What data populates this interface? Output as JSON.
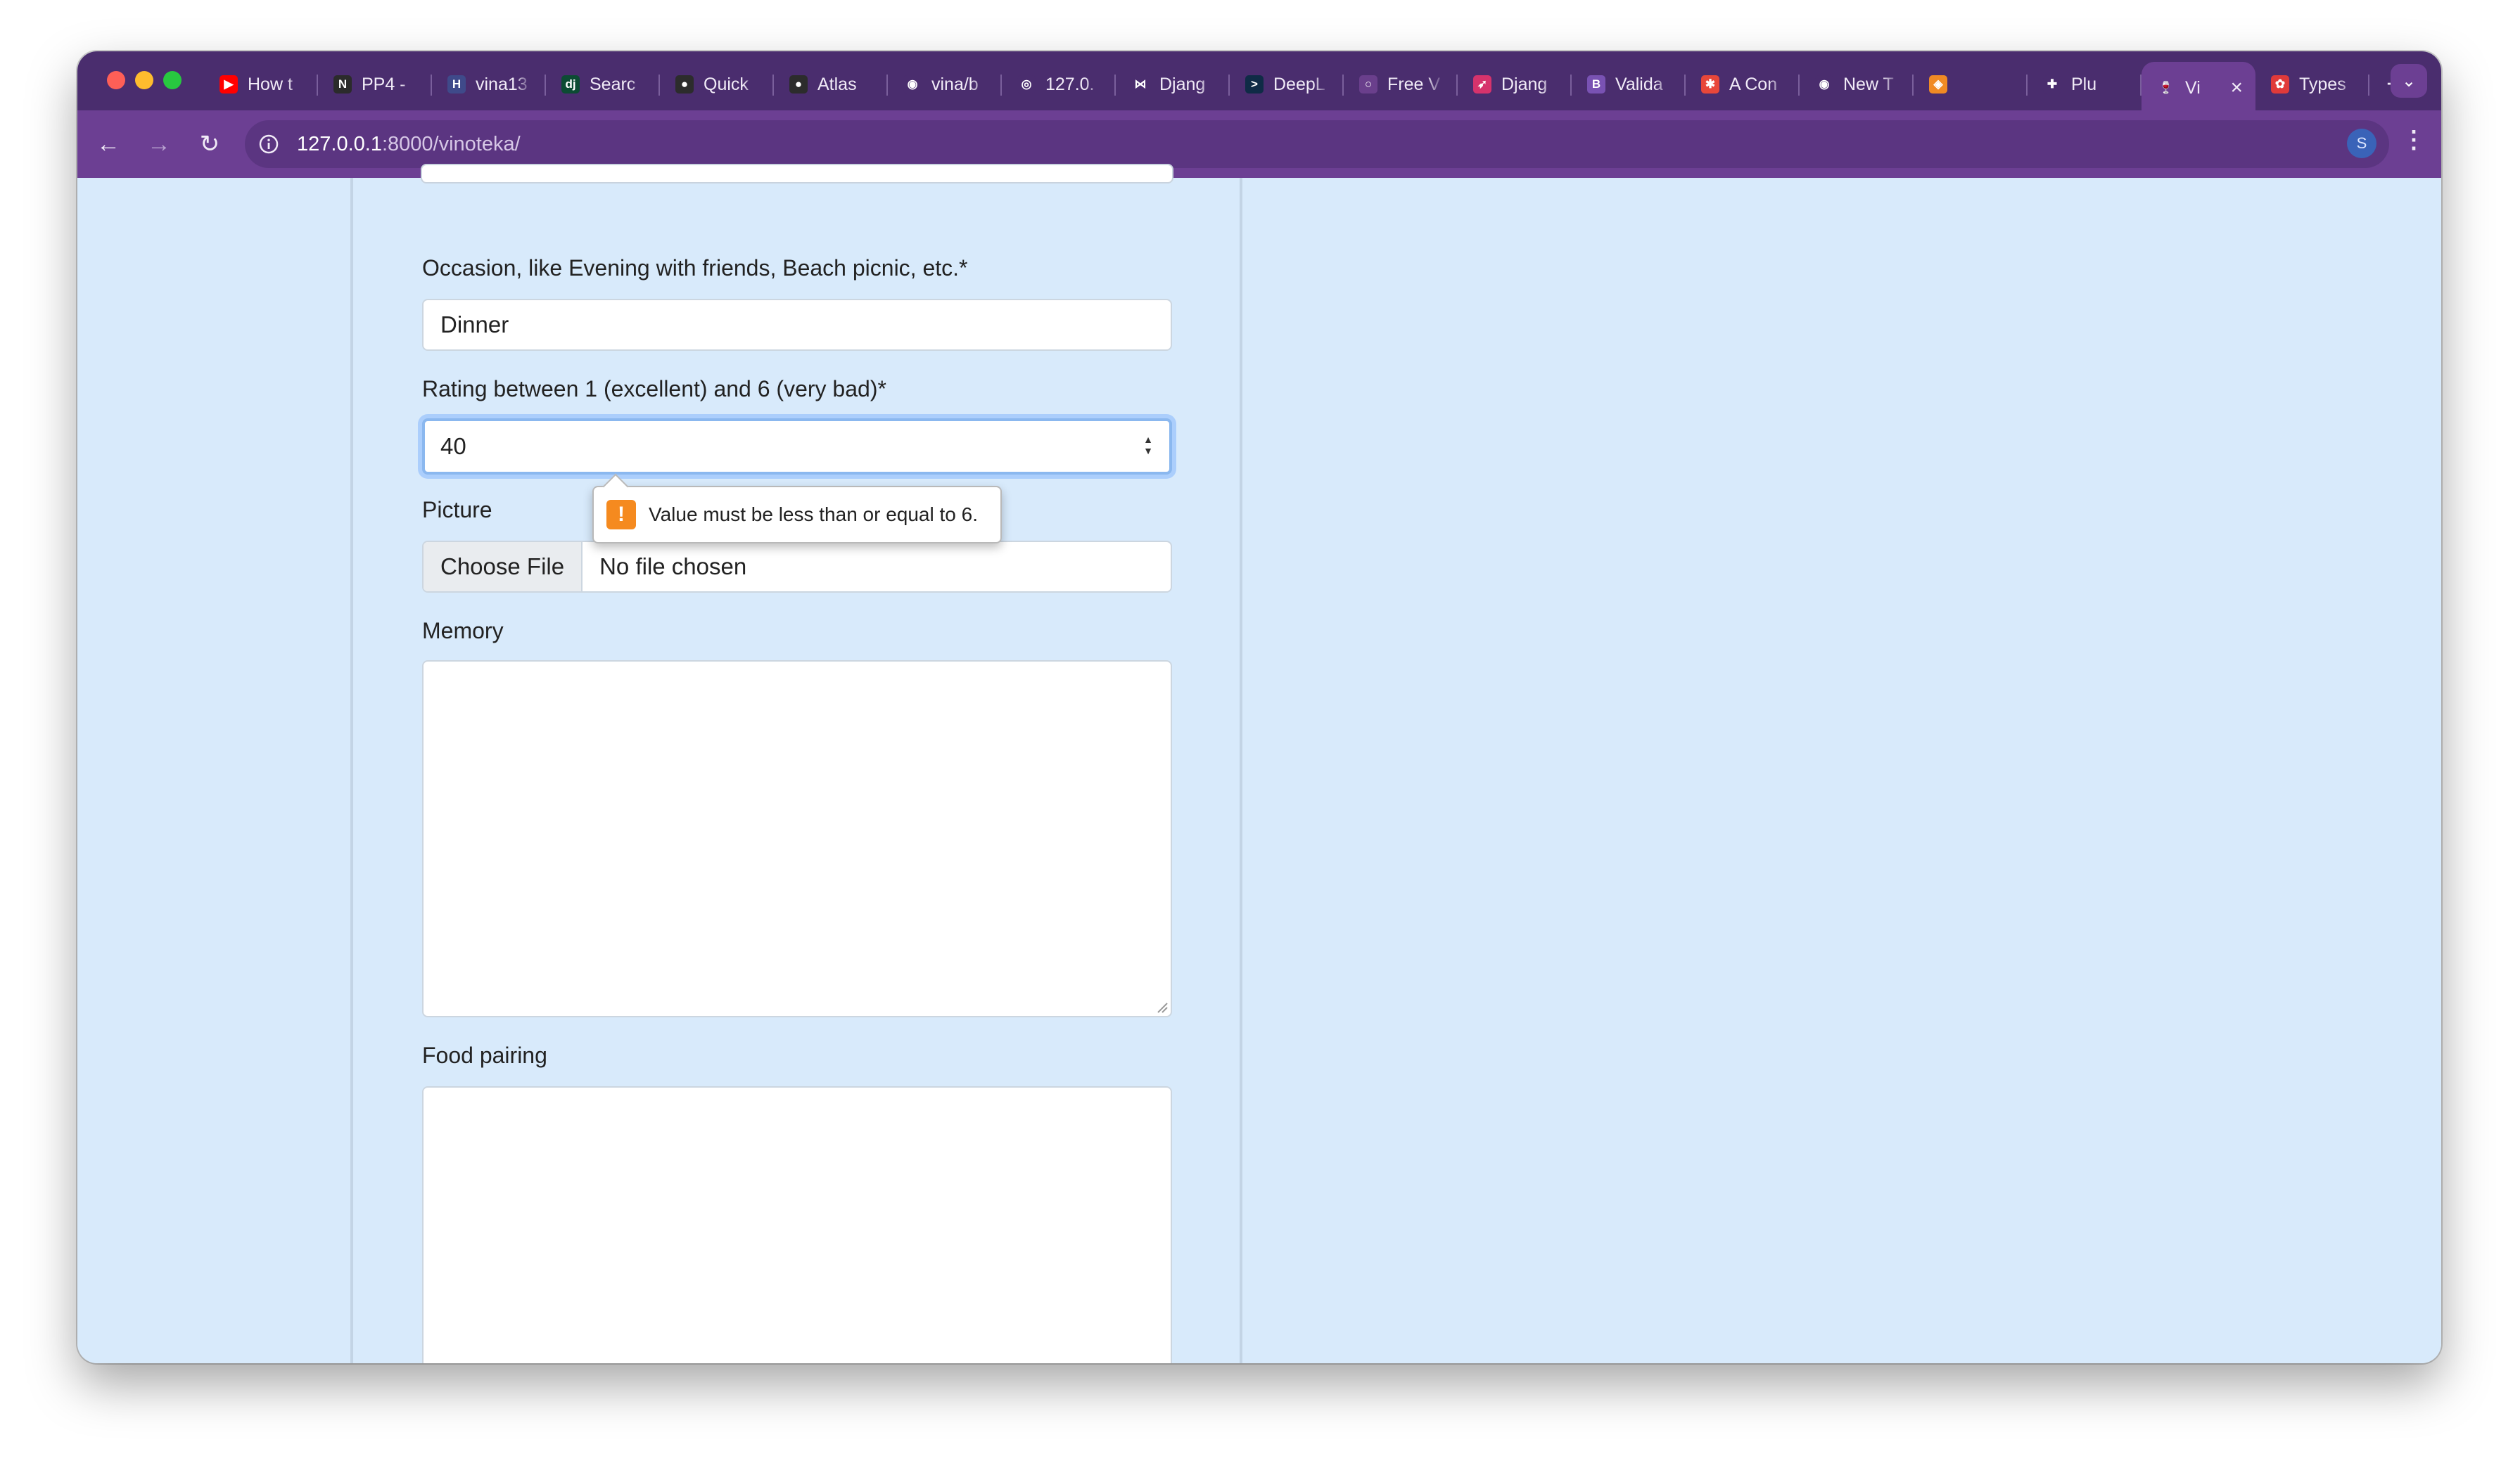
{
  "browser": {
    "traffic_colors": {
      "close": "#fe5f57",
      "minimize": "#febc2e",
      "zoom": "#28c840"
    },
    "tabs": [
      {
        "label": "How t",
        "icon": "youtube-icon",
        "color": "#ff0000",
        "glyph": "▶"
      },
      {
        "label": "PP4 -",
        "icon": "notion-icon",
        "color": "#2b2b2b",
        "glyph": "N"
      },
      {
        "label": "vina13",
        "icon": "hashnode-icon",
        "color": "#3f4a8a",
        "glyph": "H"
      },
      {
        "label": "Searc",
        "icon": "django-icon",
        "color": "#0c4b33",
        "glyph": "dj"
      },
      {
        "label": "Quick",
        "icon": "mongodb-icon",
        "color": "#2c2c2c",
        "glyph": "●"
      },
      {
        "label": "Atlas",
        "icon": "mongodb-icon",
        "color": "#2c2c2c",
        "glyph": "●"
      },
      {
        "label": "vina/b",
        "icon": "github-icon",
        "color": "#4a2d6e",
        "glyph": "◉"
      },
      {
        "label": "127.0.",
        "icon": "globe-icon",
        "color": "#4a2d6e",
        "glyph": "◎"
      },
      {
        "label": "Djang",
        "icon": "bowtie-icon",
        "color": "#4a2d6e",
        "glyph": "⋈"
      },
      {
        "label": "DeepL",
        "icon": "deepl-icon",
        "color": "#0f2b46",
        "glyph": ">"
      },
      {
        "label": "Free V",
        "icon": "shield-icon",
        "color": "#6a3f8c",
        "glyph": "○"
      },
      {
        "label": "Djang",
        "icon": "rocket-icon",
        "color": "#d6336c",
        "glyph": "➶"
      },
      {
        "label": "Valida",
        "icon": "bootstrap-icon",
        "color": "#7952b3",
        "glyph": "B"
      },
      {
        "label": "A Con",
        "icon": "asterisk-icon",
        "color": "#e8473a",
        "glyph": "✱"
      },
      {
        "label": "New T",
        "icon": "chrome-icon",
        "color": "#4a2d6e",
        "glyph": "◉"
      },
      {
        "label": "",
        "icon": "extension-icon",
        "color": "#f08a24",
        "glyph": "◈"
      },
      {
        "label": "Plu",
        "icon": "puzzle-icon",
        "color": "#4a2d6e",
        "glyph": "✚"
      },
      {
        "label": "Vi",
        "icon": "wine-glass-icon",
        "color": "#6c3f93",
        "glyph": "🍷",
        "active": true
      },
      {
        "label": "Types",
        "icon": "react-icon",
        "color": "#e03a3a",
        "glyph": "✿"
      }
    ],
    "url_host": "127.0.0.1",
    "url_path": ":8000/vinoteka/",
    "profile_initial": "S"
  },
  "form": {
    "occasion": {
      "label": "Occasion, like Evening with friends, Beach picnic, etc.*",
      "value": "Dinner"
    },
    "rating": {
      "label": "Rating between 1 (excellent) and 6 (very bad)*",
      "value": "40"
    },
    "validation_message": "Value must be less than or equal to 6.",
    "picture": {
      "label": "Picture",
      "button": "Choose File",
      "status": "No file chosen"
    },
    "memory": {
      "label": "Memory"
    },
    "food_pairing": {
      "label": "Food pairing"
    }
  }
}
